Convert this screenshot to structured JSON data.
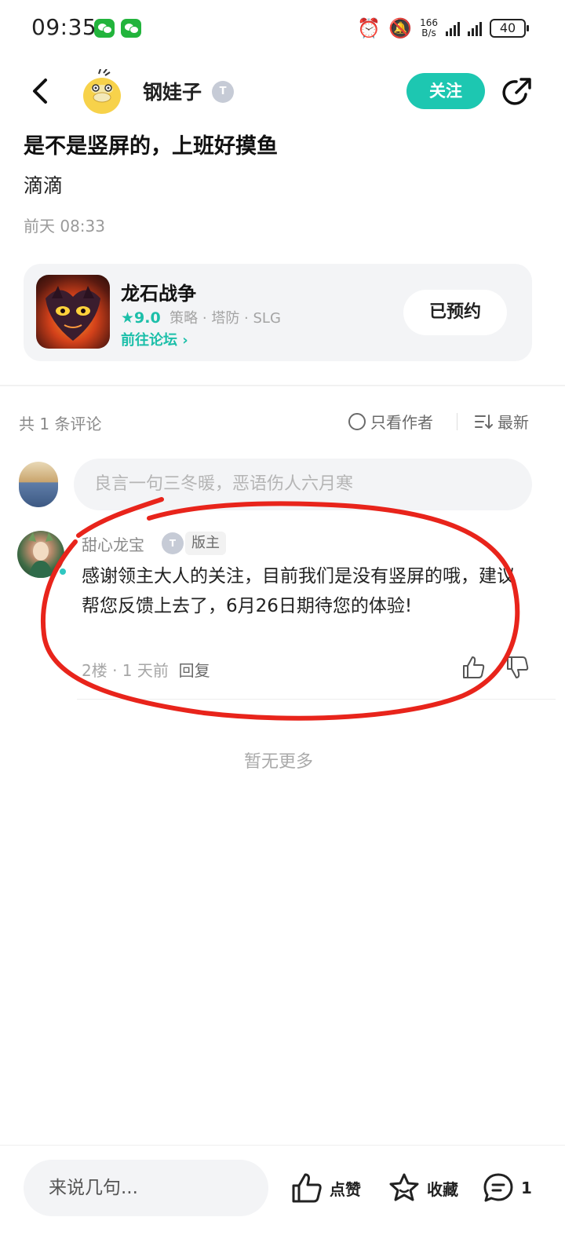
{
  "status_bar": {
    "time": "09:35",
    "net_speed_value": "166",
    "net_speed_unit": "B/s",
    "battery": "40"
  },
  "header": {
    "author_name": "钢娃子",
    "author_badge": "T",
    "follow_label": "关注"
  },
  "post": {
    "title": "是不是竖屏的，上班好摸鱼",
    "body": "滴滴",
    "time": "前天 08:33"
  },
  "game_card": {
    "name": "龙石战争",
    "score": "★9.0",
    "tags": "策略 · 塔防 · SLG",
    "forum_link": "前往论坛 ›",
    "reserve_label": "已预约"
  },
  "comments": {
    "count_label": "共 1 条评论",
    "only_author_label": "只看作者",
    "sort_label": "最新",
    "input_placeholder": "良言一句三冬暖，恶语伤人六月寒",
    "items": [
      {
        "user": "甜心龙宝",
        "badge": "T",
        "role": "版主",
        "text": "感谢领主大人的关注，目前我们是没有竖屏的哦，建议帮您反馈上去了，6月26日期待您的体验!",
        "floor_time": "2楼 · 1 天前",
        "reply_label": "回复"
      }
    ],
    "no_more": "暂无更多"
  },
  "bottom_bar": {
    "input_placeholder": "来说几句...",
    "like_label": "点赞",
    "favorite_label": "收藏",
    "comment_count": "1"
  },
  "colors": {
    "accent": "#1dc7b1",
    "annotation_red": "#e8241b"
  }
}
